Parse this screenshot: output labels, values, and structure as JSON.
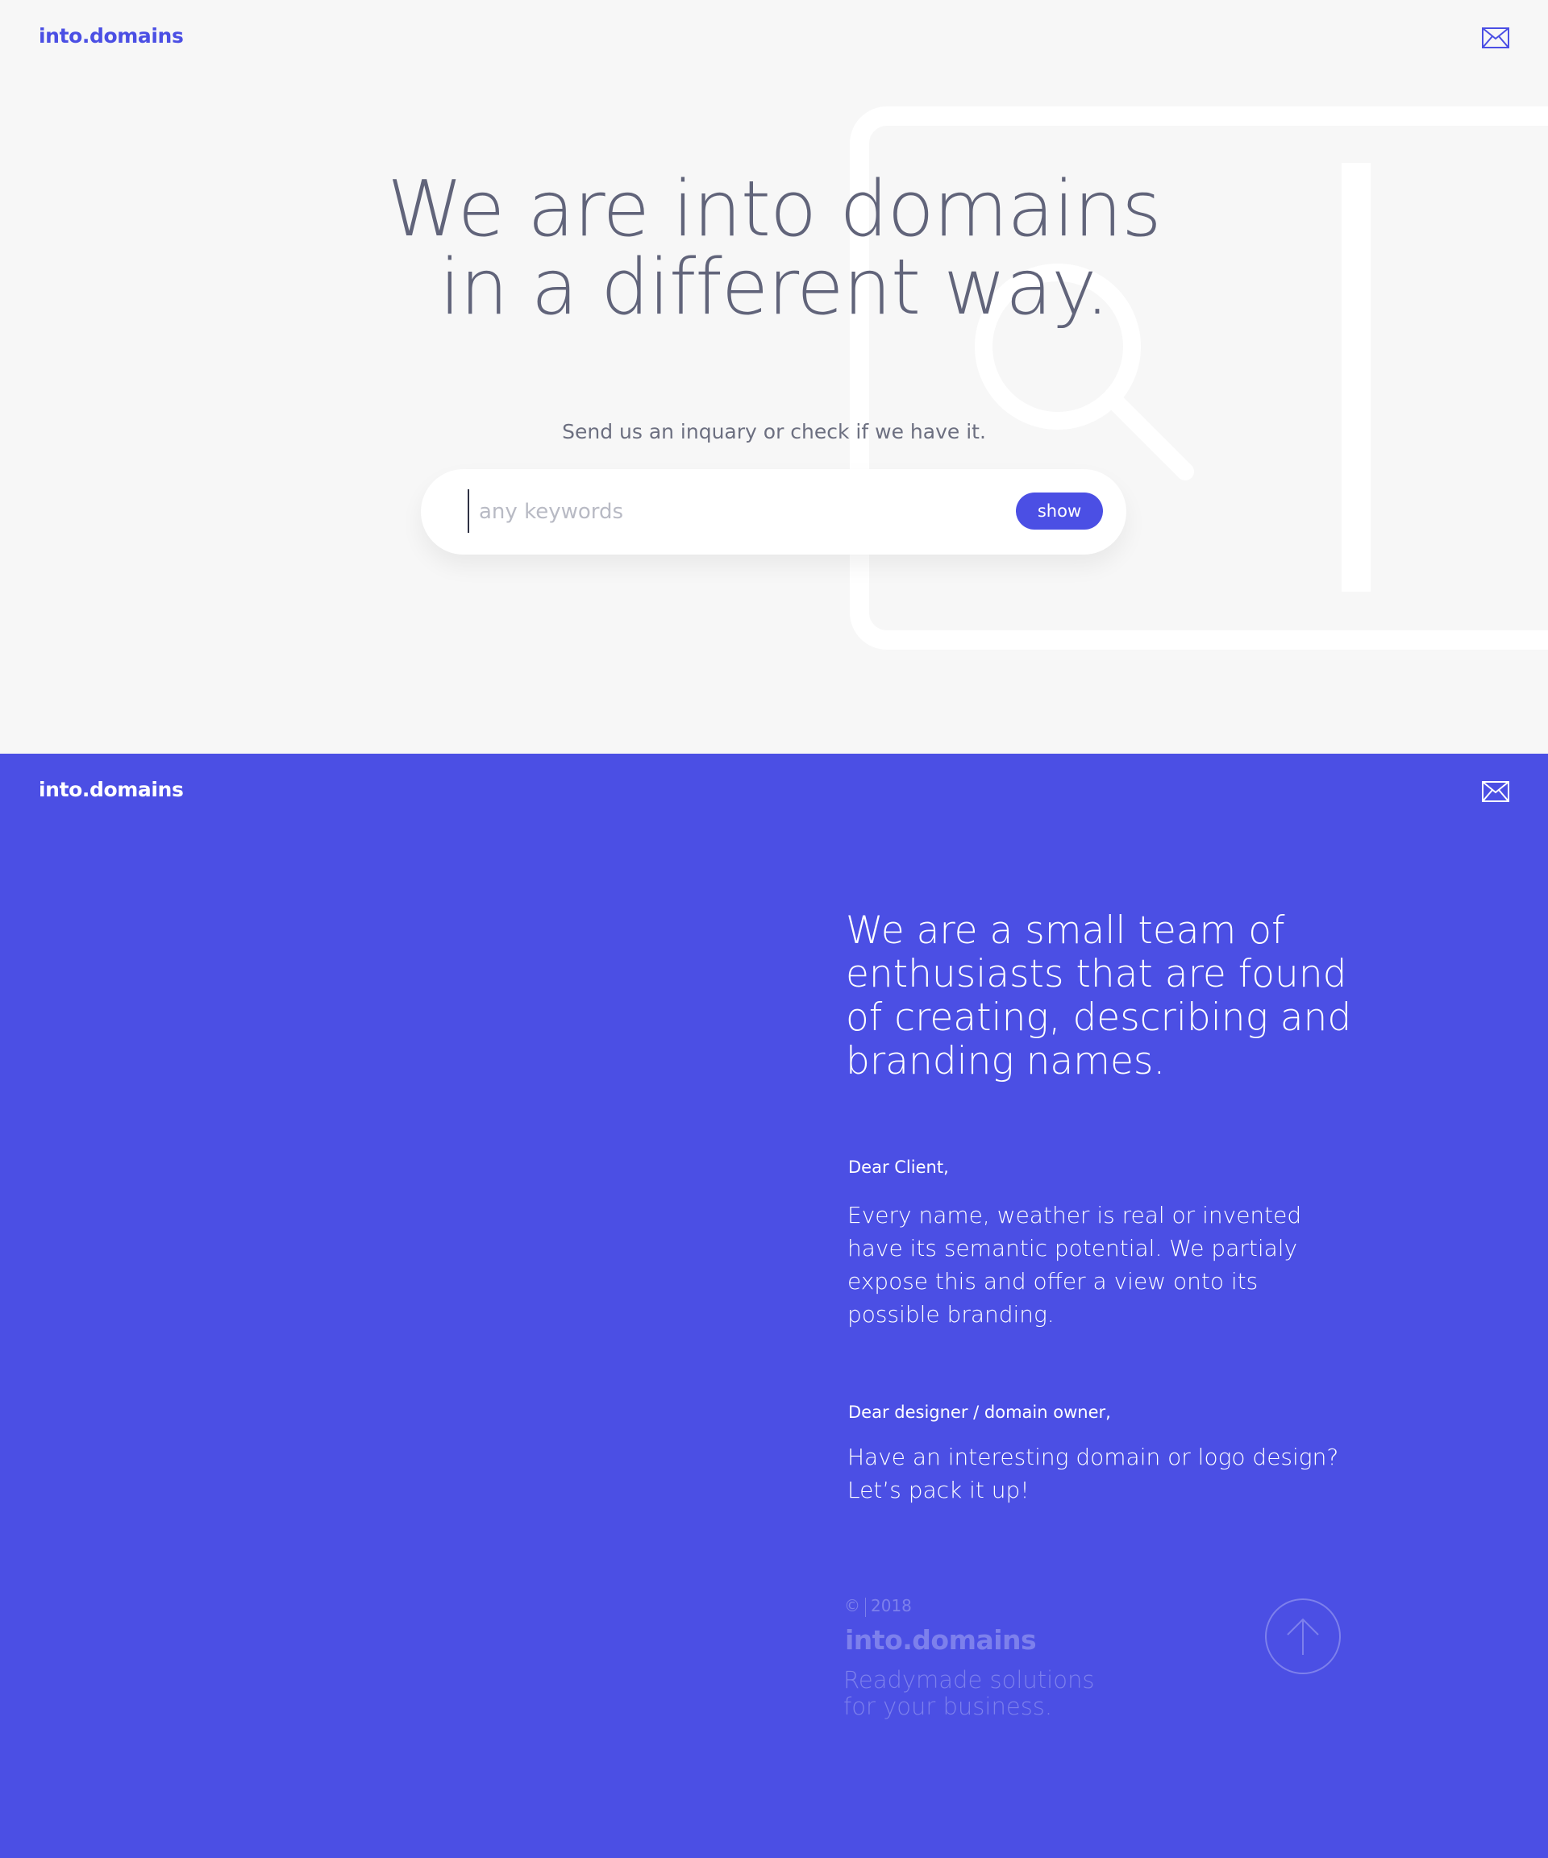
{
  "hero": {
    "logo": "into.domains",
    "title_lines": [
      "We are into domains",
      "in a different way."
    ],
    "subtitle": "Send us an inquary or check if we have it.",
    "search": {
      "placeholder": "any keywords",
      "value": "",
      "button_label": "show"
    }
  },
  "about": {
    "logo": "into.domains",
    "heading_lines": [
      "We are a small team of",
      "enthusiasts that are found",
      "of creating, describing and",
      "branding names."
    ],
    "client": {
      "greeting": "Dear Client,",
      "lines": [
        "Every name, weather is real or invented",
        "have its semantic potential. We partialy",
        "expose this and offer a view onto its",
        "possible branding."
      ]
    },
    "designer": {
      "greeting": "Dear designer / domain owner,",
      "lines": [
        "Have an interesting domain or logo design?",
        "Let’s pack it up!"
      ]
    }
  },
  "footer": {
    "copyright_symbol": "©",
    "year": "2018",
    "brand": "into.domains",
    "tagline_lines": [
      "Readymade solutions",
      "for your business."
    ]
  },
  "icons": {
    "mail": "mail-icon",
    "to_top": "arrow-up-icon",
    "illustration": "browser-search-illustration"
  },
  "colors": {
    "brand": "#4b4fe4",
    "hero_bg": "#f7f7f7",
    "text_dark": "#61647a",
    "footer_muted": "#7d80ec"
  }
}
